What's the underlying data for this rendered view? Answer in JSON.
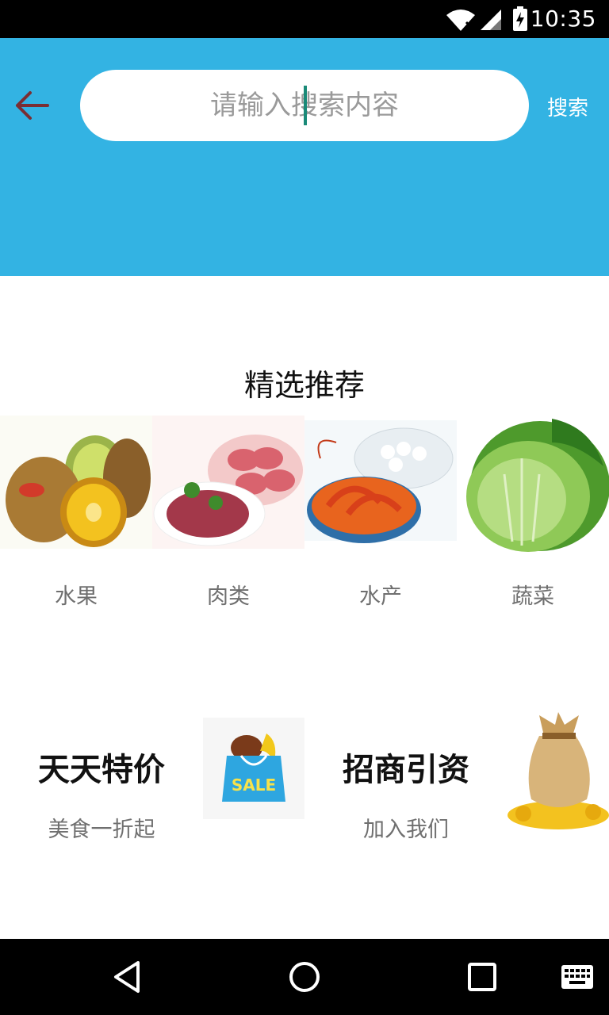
{
  "status_bar": {
    "time": "10:35"
  },
  "header": {
    "search_placeholder": "请输入搜索内容",
    "search_button": "搜索",
    "background_color": "#33b3e3"
  },
  "section": {
    "title": "精选推荐",
    "categories": [
      {
        "label": "水果",
        "icon": "kiwi-fruit-image"
      },
      {
        "label": "肉类",
        "icon": "meat-image"
      },
      {
        "label": "水产",
        "icon": "seafood-image"
      },
      {
        "label": "蔬菜",
        "icon": "cabbage-image"
      }
    ]
  },
  "promos": [
    {
      "title": "天天特价",
      "subtitle": "美食一折起",
      "icon": "sale-bag-image"
    },
    {
      "title": "招商引资",
      "subtitle": "加入我们",
      "icon": "money-bag-image"
    }
  ],
  "nav_bar": {
    "icons": [
      "back-icon",
      "home-icon",
      "recents-icon",
      "keyboard-icon"
    ]
  }
}
